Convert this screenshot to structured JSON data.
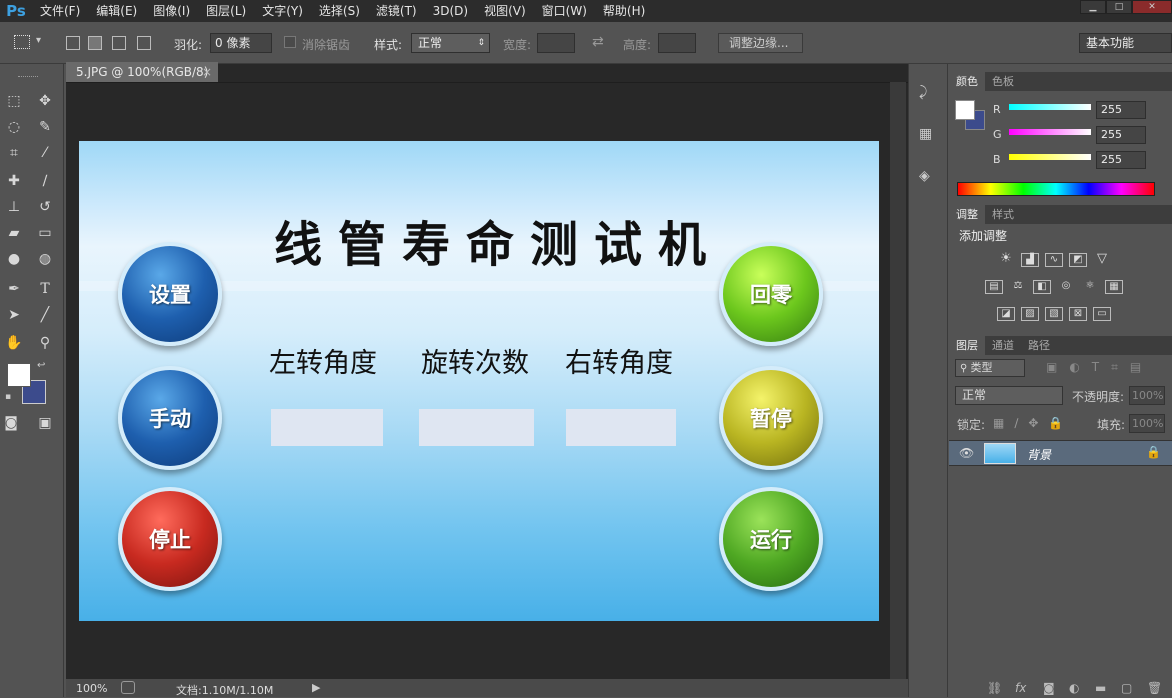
{
  "app": {
    "logo": "Ps"
  },
  "menu": [
    "文件(F)",
    "编辑(E)",
    "图像(I)",
    "图层(L)",
    "文字(Y)",
    "选择(S)",
    "滤镜(T)",
    "3D(D)",
    "视图(V)",
    "窗口(W)",
    "帮助(H)"
  ],
  "options": {
    "feather_label": "羽化:",
    "feather_value": "0 像素",
    "antialias_label": "消除锯齿",
    "style_label": "样式:",
    "style_value": "正常",
    "width_label": "宽度:",
    "height_label": "高度:",
    "refine_edge": "调整边缘...",
    "workspace": "基本功能"
  },
  "document": {
    "tab": "5.JPG @ 100%(RGB/8)",
    "zoom": "100%",
    "doc_size": "文档:1.10M/1.10M"
  },
  "canvas": {
    "title": "线管寿命测试机",
    "labels": [
      "左转角度",
      "旋转次数",
      "右转角度"
    ],
    "left_buttons": [
      "设置",
      "手动",
      "停止"
    ],
    "right_buttons": [
      "回零",
      "暂停",
      "运行"
    ]
  },
  "color_panel": {
    "tabs": [
      "颜色",
      "色板"
    ],
    "channels": [
      {
        "label": "R",
        "value": "255"
      },
      {
        "label": "G",
        "value": "255"
      },
      {
        "label": "B",
        "value": "255"
      }
    ]
  },
  "adjust_panel": {
    "tabs": [
      "调整",
      "样式"
    ],
    "heading": "添加调整"
  },
  "layers_panel": {
    "tabs": [
      "图层",
      "通道",
      "路径"
    ],
    "filter": "类型",
    "blend": "正常",
    "opacity_label": "不透明度:",
    "opacity_value": "100%",
    "lock_label": "锁定:",
    "fill_label": "填充:",
    "fill_value": "100%",
    "layer_name": "背景"
  },
  "colors": {
    "accent": "#3da0e0",
    "fg": "#ffffff",
    "bg": "#3c4b8c"
  },
  "icons": [
    "marquee-icon",
    "move-icon",
    "lasso-icon",
    "quick-select-icon",
    "crop-icon",
    "eyedropper-icon",
    "healing-icon",
    "brush-icon",
    "stamp-icon",
    "history-brush-icon",
    "eraser-icon",
    "gradient-icon",
    "blur-icon",
    "dodge-icon",
    "pen-icon",
    "text-icon",
    "path-select-icon",
    "line-icon",
    "hand-icon",
    "zoom-icon"
  ]
}
